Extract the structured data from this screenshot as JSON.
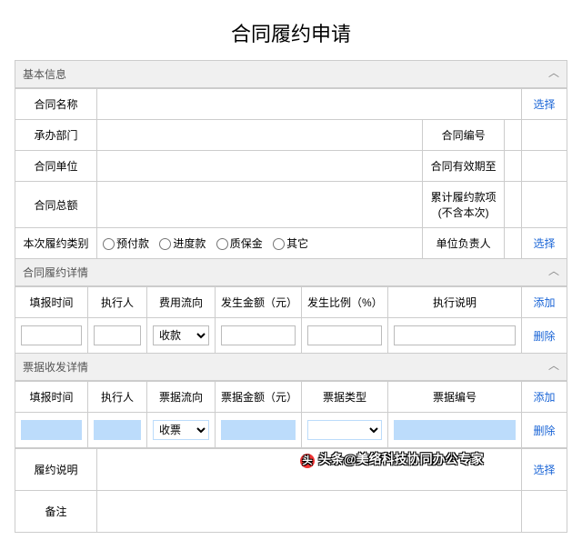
{
  "title": "合同履约申请",
  "sections": {
    "basic": "基本信息",
    "detail": "合同履约详情",
    "invoice": "票据收发详情"
  },
  "labels": {
    "contractName": "合同名称",
    "department": "承办部门",
    "contractNo": "合同编号",
    "contractUnit": "合同单位",
    "validUntil": "合同有效期至",
    "totalAmount": "合同总额",
    "accumulated": "累计履约款项\n(不含本次)",
    "category": "本次履约类别",
    "manager": "单位负责人",
    "perfNote": "履约说明",
    "remark": "备注"
  },
  "radios": {
    "r1": "预付款",
    "r2": "进度款",
    "r3": "质保金",
    "r4": "其它"
  },
  "actions": {
    "select": "选择",
    "add": "添加",
    "del": "删除"
  },
  "detailHeaders": {
    "h1": "填报时间",
    "h2": "执行人",
    "h3": "费用流向",
    "h4": "发生金额（元）",
    "h5": "发生比例（%）",
    "h6": "执行说明"
  },
  "detailRow": {
    "flow": "收款"
  },
  "invoiceHeaders": {
    "h1": "填报时间",
    "h2": "执行人",
    "h3": "票据流向",
    "h4": "票据金额（元）",
    "h5": "票据类型",
    "h6": "票据编号"
  },
  "invoiceRow": {
    "flow": "收票"
  },
  "watermark": "头条@美络科技协同办公专家"
}
